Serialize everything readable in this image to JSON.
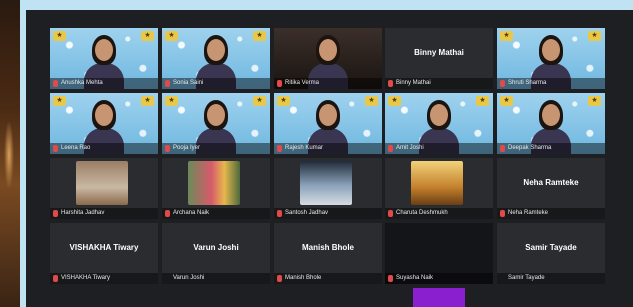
{
  "meeting": {
    "tiles": [
      {
        "label": "Anushka Mehta",
        "kind": "video",
        "bg": "bokeh",
        "muted": true
      },
      {
        "label": "Sonia Saini",
        "kind": "video",
        "bg": "bokeh",
        "muted": true
      },
      {
        "label": "Ritika Verma",
        "kind": "video",
        "bg": "room",
        "muted": true,
        "active": true
      },
      {
        "label": "Binny Mathai",
        "kind": "name",
        "display": "Binny Mathai",
        "muted": true
      },
      {
        "label": "Shruti Sharma",
        "kind": "video",
        "bg": "bokeh",
        "muted": true
      },
      {
        "label": "Leena Rao",
        "kind": "video",
        "bg": "bokeh",
        "muted": true
      },
      {
        "label": "Pooja Iyer",
        "kind": "video",
        "bg": "bokeh",
        "muted": true
      },
      {
        "label": "Rajesh Kumar",
        "kind": "video",
        "bg": "bokeh",
        "muted": true
      },
      {
        "label": "Amit Joshi",
        "kind": "video",
        "bg": "bokeh",
        "muted": true
      },
      {
        "label": "Deepak Sharma",
        "kind": "video",
        "bg": "bokeh",
        "muted": true
      },
      {
        "label": "Harshita Jadhav",
        "kind": "thumb",
        "thumb": "th1",
        "muted": true
      },
      {
        "label": "Archana Naik",
        "kind": "thumb",
        "thumb": "th2",
        "muted": true
      },
      {
        "label": "Santosh Jadhav",
        "kind": "thumb",
        "thumb": "th3",
        "muted": true
      },
      {
        "label": "Charuta Deshmukh",
        "kind": "thumb",
        "thumb": "th4",
        "muted": true
      },
      {
        "label": "Neha Ramteke",
        "kind": "name",
        "display": "Neha Ramteke",
        "muted": true
      },
      {
        "label": "VISHAKHA Tiwary",
        "kind": "name",
        "display": "VISHAKHA Tiwary",
        "muted": true
      },
      {
        "label": "Varun Joshi",
        "kind": "name",
        "display": "Varun Joshi",
        "muted": false
      },
      {
        "label": "Manish Bhole",
        "kind": "name",
        "display": "Manish Bhole",
        "muted": true
      },
      {
        "label": "Suyasha Naik",
        "kind": "dark",
        "muted": true
      },
      {
        "label": "Samir Tayade",
        "kind": "name",
        "display": "Samir Tayade",
        "muted": false
      },
      {
        "label": "",
        "kind": "purple",
        "muted": false
      }
    ]
  }
}
